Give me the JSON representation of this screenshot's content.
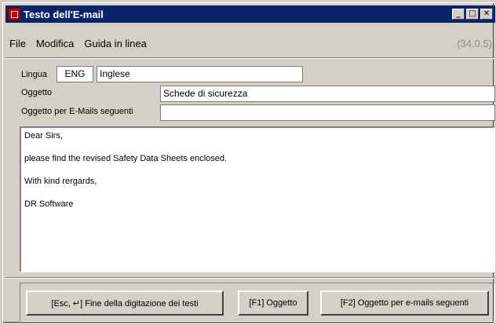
{
  "window": {
    "title": "Testo dell'E-mail",
    "controls": {
      "minimize": "_",
      "maximize": "□",
      "close": "✕"
    }
  },
  "menu": {
    "items": [
      "File",
      "Modifica",
      "Guida in linea"
    ],
    "version": "(34.0.5)"
  },
  "form": {
    "lingua_label": "Lingua",
    "lingua_code": "ENG",
    "lingua_name": "Inglese",
    "oggetto_label": "Oggetto",
    "oggetto_value": "Schede di sicurezza",
    "oggetto_seguenti_label": "Oggetto per E-Mails seguenti",
    "oggetto_seguenti_value": ""
  },
  "body_text": {
    "lines": [
      "Dear Sirs,",
      "please find the revised Safety Data Sheets enclosed.",
      "With kind rergards,",
      "DR Software"
    ]
  },
  "buttons": {
    "finish": "[Esc, ↵] Fine della digitazione dei testi",
    "oggetto": "[F1] Oggetto",
    "oggetto_seguenti": "[F2] Oggetto per e-mails seguenti"
  }
}
